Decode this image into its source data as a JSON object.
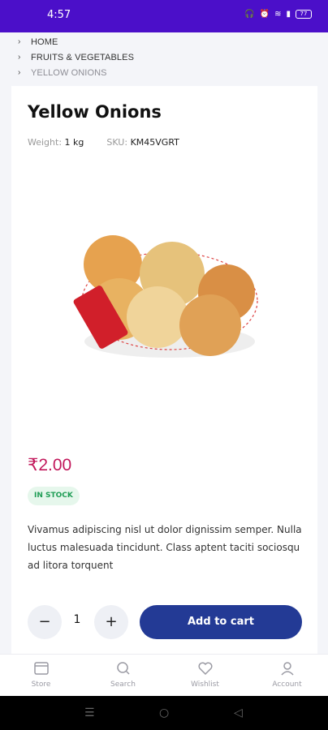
{
  "status_bar": {
    "time": "4:57",
    "battery": "77"
  },
  "breadcrumb": {
    "items": [
      "HOME",
      "FRUITS & VEGETABLES",
      "YELLOW ONIONS"
    ]
  },
  "product": {
    "title": "Yellow Onions",
    "weight_label": "Weight:",
    "weight_value": "1 kg",
    "sku_label": "SKU:",
    "sku_value": "KM45VGRT",
    "price": "₹2.00",
    "stock_status": "IN STOCK",
    "description": "Vivamus adipiscing nisl ut dolor dignissim semper. Nulla luctus malesuada tincidunt. Class aptent taciti sociosqu ad litora torquent",
    "quantity": "1",
    "add_to_cart_label": "Add to cart"
  },
  "bottom_nav": {
    "items": [
      {
        "label": "Store",
        "icon": "store-icon"
      },
      {
        "label": "Search",
        "icon": "search-icon"
      },
      {
        "label": "Wishlist",
        "icon": "heart-icon"
      },
      {
        "label": "Account",
        "icon": "user-icon"
      }
    ]
  },
  "colors": {
    "status_bar": "#4b0fc9",
    "price": "#c2185b",
    "button": "#233a95",
    "stock": "#1f9d55"
  }
}
